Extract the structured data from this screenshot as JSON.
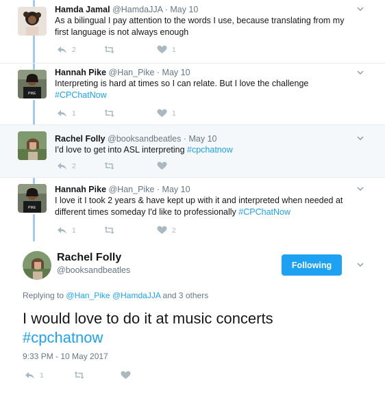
{
  "tweets": [
    {
      "name": "Hamda Jamal",
      "handle": "@HamdaJJA",
      "date": "May 10",
      "text": "As a bilingual I pay attention to the words I use, because translating from my first language is not always enough",
      "hashtag": "",
      "reply_count": "2",
      "retweet_count": "",
      "like_count": "1"
    },
    {
      "name": "Hannah Pike",
      "handle": "@Han_Pike",
      "date": "May 10",
      "text": "Interpreting is hard at times so I can relate. But I love the challenge",
      "hashtag": "#CPChatNow",
      "reply_count": "1",
      "retweet_count": "",
      "like_count": "1"
    },
    {
      "name": "Rachel Folly",
      "handle": "@booksandbeatles",
      "date": "May 10",
      "text": "I'd love to get into ASL interpreting",
      "hashtag": "#cpchatnow",
      "reply_count": "2",
      "retweet_count": "",
      "like_count": ""
    },
    {
      "name": "Hannah Pike",
      "handle": "@Han_Pike",
      "date": "May 10",
      "text": "I love it I took 2 years & have kept up with it and interpreted when needed at different times someday I'd like to professionally",
      "hashtag": "#CPChatNow",
      "reply_count": "1",
      "retweet_count": "",
      "like_count": "2"
    }
  ],
  "separator": "·",
  "main": {
    "name": "Rachel Folly",
    "handle": "@booksandbeatles",
    "follow_label": "Following",
    "replying_prefix": "Replying to",
    "replying_to_1": "@Han_Pike",
    "replying_to_2": "@HamdaJJA",
    "replying_suffix": "and 3 others",
    "text": "I would love to do it at music concerts",
    "hashtag": "#cpchatnow",
    "timestamp": "9:33 PM - 10 May 2017",
    "reply_count": "1",
    "retweet_count": "",
    "like_count": ""
  },
  "icons": {
    "reply": "reply-icon",
    "retweet": "retweet-icon",
    "like": "heart-icon",
    "more": "chevron-down-icon"
  },
  "colors": {
    "link": "#1da1f2",
    "thread": "#a3c9f0",
    "muted": "#657786",
    "highlight_bg": "#f5f8fa"
  }
}
